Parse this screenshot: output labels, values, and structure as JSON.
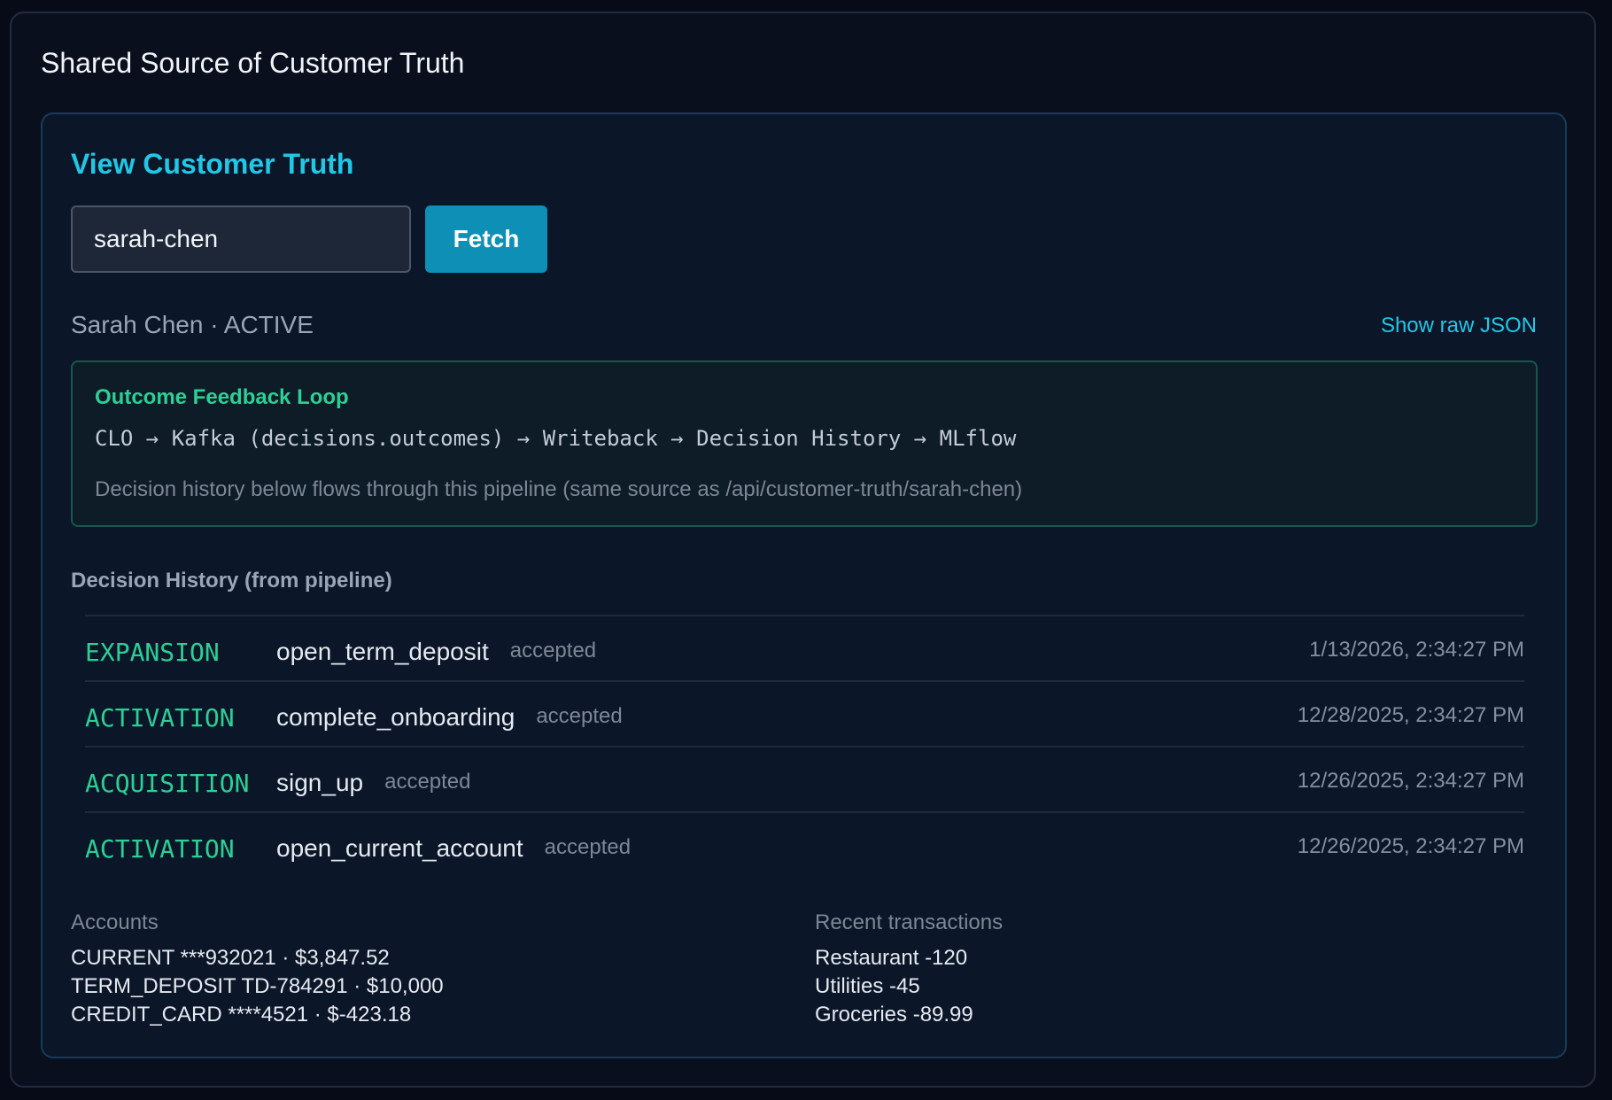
{
  "panel": {
    "title": "Shared Source of Customer Truth"
  },
  "viewer": {
    "title": "View Customer Truth",
    "search": {
      "value": "sarah-chen"
    },
    "fetch_label": "Fetch",
    "customer_line": "Sarah Chen · ACTIVE",
    "raw_json_label": "Show raw JSON"
  },
  "feedback_loop": {
    "title": "Outcome Feedback Loop",
    "pipeline": "CLO → Kafka (decisions.outcomes) → Writeback → Decision History → MLflow",
    "note": "Decision history below flows through this pipeline (same source as /api/customer-truth/sarah-chen)"
  },
  "history": {
    "title": "Decision History (from pipeline)",
    "rows": [
      {
        "stage": "EXPANSION",
        "action": "open_term_deposit",
        "status": "accepted",
        "timestamp": "1/13/2026, 2:34:27 PM"
      },
      {
        "stage": "ACTIVATION",
        "action": "complete_onboarding",
        "status": "accepted",
        "timestamp": "12/28/2025, 2:34:27 PM"
      },
      {
        "stage": "ACQUISITION",
        "action": "sign_up",
        "status": "accepted",
        "timestamp": "12/26/2025, 2:34:27 PM"
      },
      {
        "stage": "ACTIVATION",
        "action": "open_current_account",
        "status": "accepted",
        "timestamp": "12/26/2025, 2:34:27 PM"
      }
    ]
  },
  "accounts": {
    "heading": "Accounts",
    "items": [
      "CURRENT ***932021 · $3,847.52",
      "TERM_DEPOSIT TD-784291 · $10,000",
      "CREDIT_CARD ****4521 · $-423.18"
    ]
  },
  "transactions": {
    "heading": "Recent transactions",
    "items": [
      "Restaurant -120",
      "Utilities -45",
      "Groceries -89.99"
    ]
  },
  "colors": {
    "accent": "#22c7e6",
    "button": "#0e8fb5",
    "stage_green": "#2ccf95",
    "background": "#0a0f1e"
  }
}
